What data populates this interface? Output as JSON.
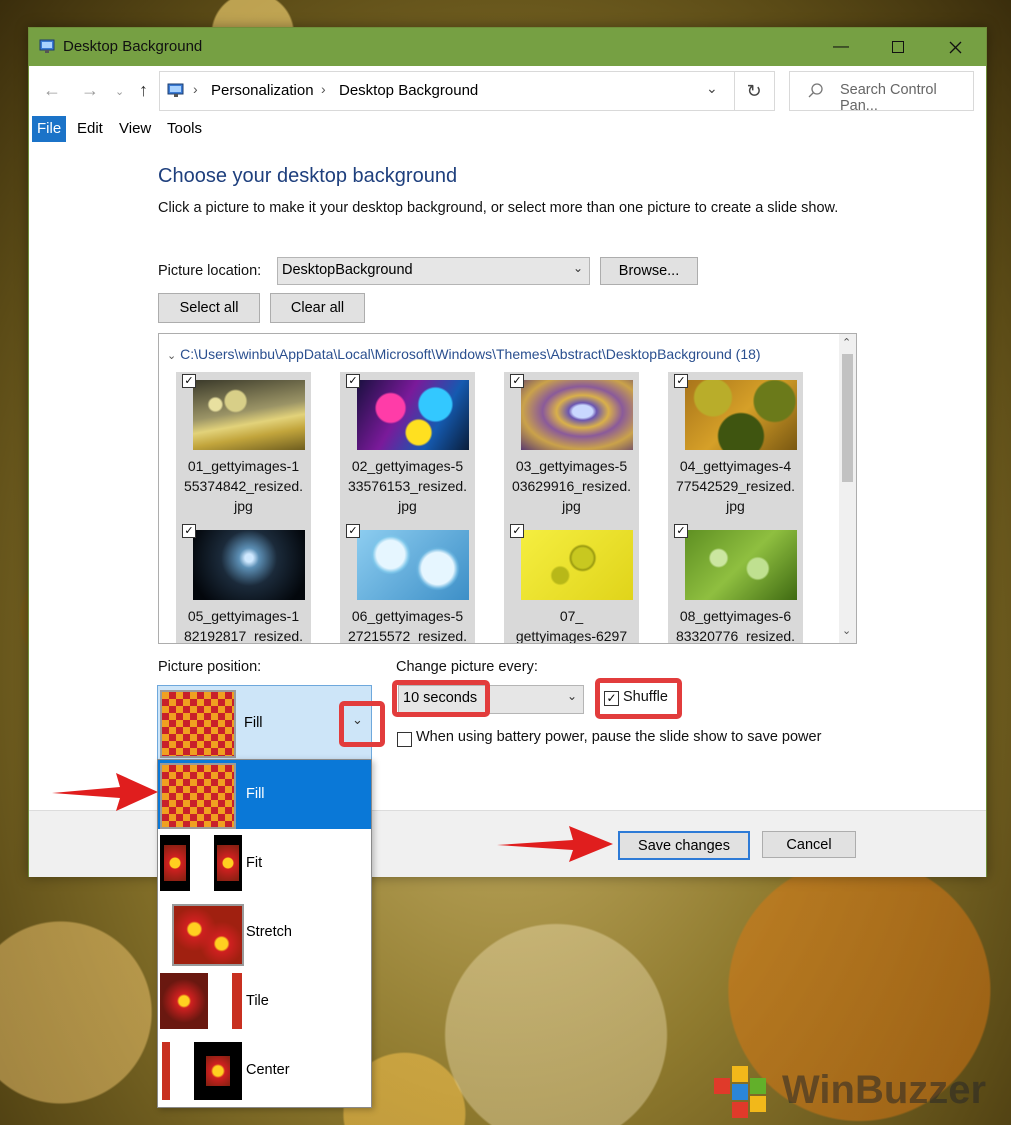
{
  "window": {
    "title": "Desktop Background"
  },
  "address": {
    "crumbs": [
      "Personalization",
      "Desktop Background"
    ],
    "search_placeholder": "Search Control Pan..."
  },
  "menu": [
    "File",
    "Edit",
    "View",
    "Tools"
  ],
  "main": {
    "heading": "Choose your desktop background",
    "description": "Click a picture to make it your desktop background, or select more than one picture to create a slide show.",
    "picture_location_label": "Picture location:",
    "picture_location_value": "DesktopBackground",
    "browse_label": "Browse...",
    "select_all_label": "Select all",
    "clear_all_label": "Clear all"
  },
  "gallery": {
    "path": "C:\\Users\\winbu\\AppData\\Local\\Microsoft\\Windows\\Themes\\Abstract\\DesktopBackground (18)",
    "items": [
      {
        "name": [
          "01_gettyimages-1",
          "55374842_resized.",
          "jpg"
        ],
        "checked": true
      },
      {
        "name": [
          "02_gettyimages-5",
          "33576153_resized.",
          "jpg"
        ],
        "checked": true
      },
      {
        "name": [
          "03_gettyimages-5",
          "03629916_resized.",
          "jpg"
        ],
        "checked": true
      },
      {
        "name": [
          "04_gettyimages-4",
          "77542529_resized.",
          "jpg"
        ],
        "checked": true
      },
      {
        "name": [
          "05_gettyimages-1",
          "82192817_resized.",
          ""
        ],
        "checked": true
      },
      {
        "name": [
          "06_gettyimages-5",
          "27215572_resized.",
          ""
        ],
        "checked": true
      },
      {
        "name": [
          "07_",
          "gettyimages-6297",
          ""
        ],
        "checked": true
      },
      {
        "name": [
          "08_gettyimages-6",
          "83320776_resized.",
          ""
        ],
        "checked": true
      }
    ]
  },
  "position": {
    "label": "Picture position:",
    "selected": "Fill",
    "options": [
      "Fill",
      "Fit",
      "Stretch",
      "Tile",
      "Center"
    ]
  },
  "interval": {
    "label": "Change picture every:",
    "value": "10 seconds",
    "shuffle_label": "Shuffle",
    "shuffle_checked": true,
    "battery_label": "When using battery power, pause the slide show to save power",
    "battery_checked": false
  },
  "footer": {
    "save_label": "Save changes",
    "cancel_label": "Cancel"
  },
  "watermark": {
    "brand": "WinBuzzer"
  },
  "colors": {
    "titlebar": "#76a043",
    "accent": "#0a78d7",
    "highlight": "#e23c3c",
    "heading": "#1e3f7d"
  }
}
